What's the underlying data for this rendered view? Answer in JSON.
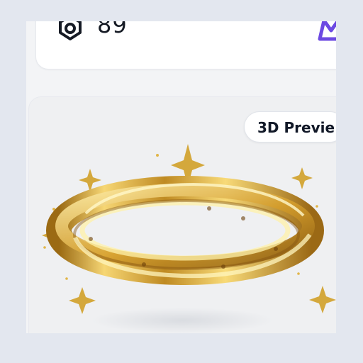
{
  "stats": {
    "value": "89",
    "icon": "badge-icon",
    "side_icon": "crown-icon",
    "accent_color": "#6d4ae2"
  },
  "preview": {
    "button_label": "3D Previe",
    "artwork": "golden-ring",
    "gold_color": "#c89a2d",
    "sparkle_color": "#d4a83c"
  }
}
